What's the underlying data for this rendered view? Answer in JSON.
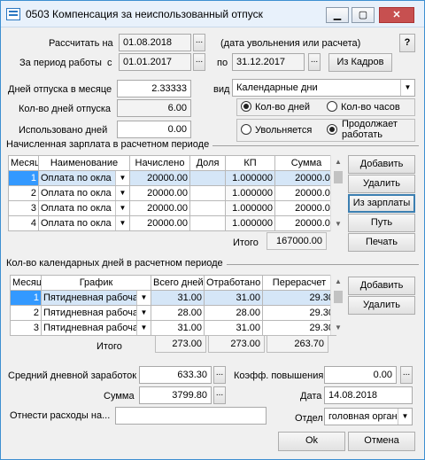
{
  "window": {
    "title": "0503 Компенсация за неиспользованный отпуск",
    "minimize": "▁",
    "maximize": "▢",
    "close": "✕"
  },
  "period": {
    "calc_label": "Рассчитать на",
    "calc_date": "01.08.2018",
    "calc_hint": "(дата увольнения или расчета)",
    "help": "?",
    "work_label": "За период работы",
    "from_label": "с",
    "from_date": "01.01.2017",
    "to_label": "по",
    "to_date": "31.12.2017",
    "from_hr_button": "Из Кадров",
    "ellipsis": "..."
  },
  "vacation": {
    "days_per_month_label": "Дней отпуска в месяце",
    "days_per_month": "2.33333",
    "kind_label": "вид",
    "kind_value": "Календарные дни",
    "days_count_label": "Кол-во дней отпуска",
    "days_count": "6.00",
    "used_label": "Использовано дней",
    "used": "0.00",
    "radio_days": "Кол-во дней",
    "radio_hours": "Кол-во часов",
    "radio_fired": "Увольняется",
    "radio_works_line1": "Продолжает",
    "radio_works_line2": "работать"
  },
  "salary": {
    "group_title": "Начисленная зарплата в расчетном периоде",
    "columns": [
      "Месяц",
      "Наименование",
      "Начислено",
      "Доля",
      "КП",
      "Сумма"
    ],
    "rows": [
      {
        "n": "1",
        "name": "Оплата по окла",
        "accrued": "20000.00",
        "share": "",
        "kp": "1.000000",
        "sum": "20000.00"
      },
      {
        "n": "2",
        "name": "Оплата по окла",
        "accrued": "20000.00",
        "share": "",
        "kp": "1.000000",
        "sum": "20000.00"
      },
      {
        "n": "3",
        "name": "Оплата по окла",
        "accrued": "20000.00",
        "share": "",
        "kp": "1.000000",
        "sum": "20000.00"
      },
      {
        "n": "4",
        "name": "Оплата по окла",
        "accrued": "20000.00",
        "share": "",
        "kp": "1.000000",
        "sum": "20000.00"
      }
    ],
    "total_label": "Итого",
    "total": "167000.00",
    "btn_add": "Добавить",
    "btn_delete": "Удалить",
    "btn_from_salary": "Из зарплаты",
    "btn_path": "Путь",
    "btn_print": "Печать"
  },
  "calendar": {
    "group_title": "Кол-во календарных дней в расчетном периоде",
    "columns": [
      "Месяц",
      "График",
      "Всего дней",
      "Отработано",
      "Перерасчет"
    ],
    "rows": [
      {
        "n": "1",
        "schedule": "Пятидневная рабоча",
        "total": "31.00",
        "worked": "31.00",
        "recalc": "29.30"
      },
      {
        "n": "2",
        "schedule": "Пятидневная рабоча",
        "total": "28.00",
        "worked": "28.00",
        "recalc": "29.30"
      },
      {
        "n": "3",
        "schedule": "Пятидневная рабоча",
        "total": "31.00",
        "worked": "31.00",
        "recalc": "29.30"
      }
    ],
    "total_label": "Итого",
    "total_days": "273.00",
    "total_worked": "273.00",
    "total_recalc": "263.70",
    "btn_add": "Добавить",
    "btn_delete": "Удалить"
  },
  "result": {
    "avg_label": "Средний дневной заработок",
    "avg": "633.30",
    "coef_label": "Коэфф. повышения",
    "coef": "0.00",
    "sum_label": "Сумма",
    "sum": "3799.80",
    "date_label": "Дата",
    "date": "14.08.2018",
    "expense_label": "Отнести расходы на...",
    "expense": "",
    "dept_label": "Отдел",
    "dept": "головная орган",
    "ok": "Ok",
    "cancel": "Отмена"
  }
}
